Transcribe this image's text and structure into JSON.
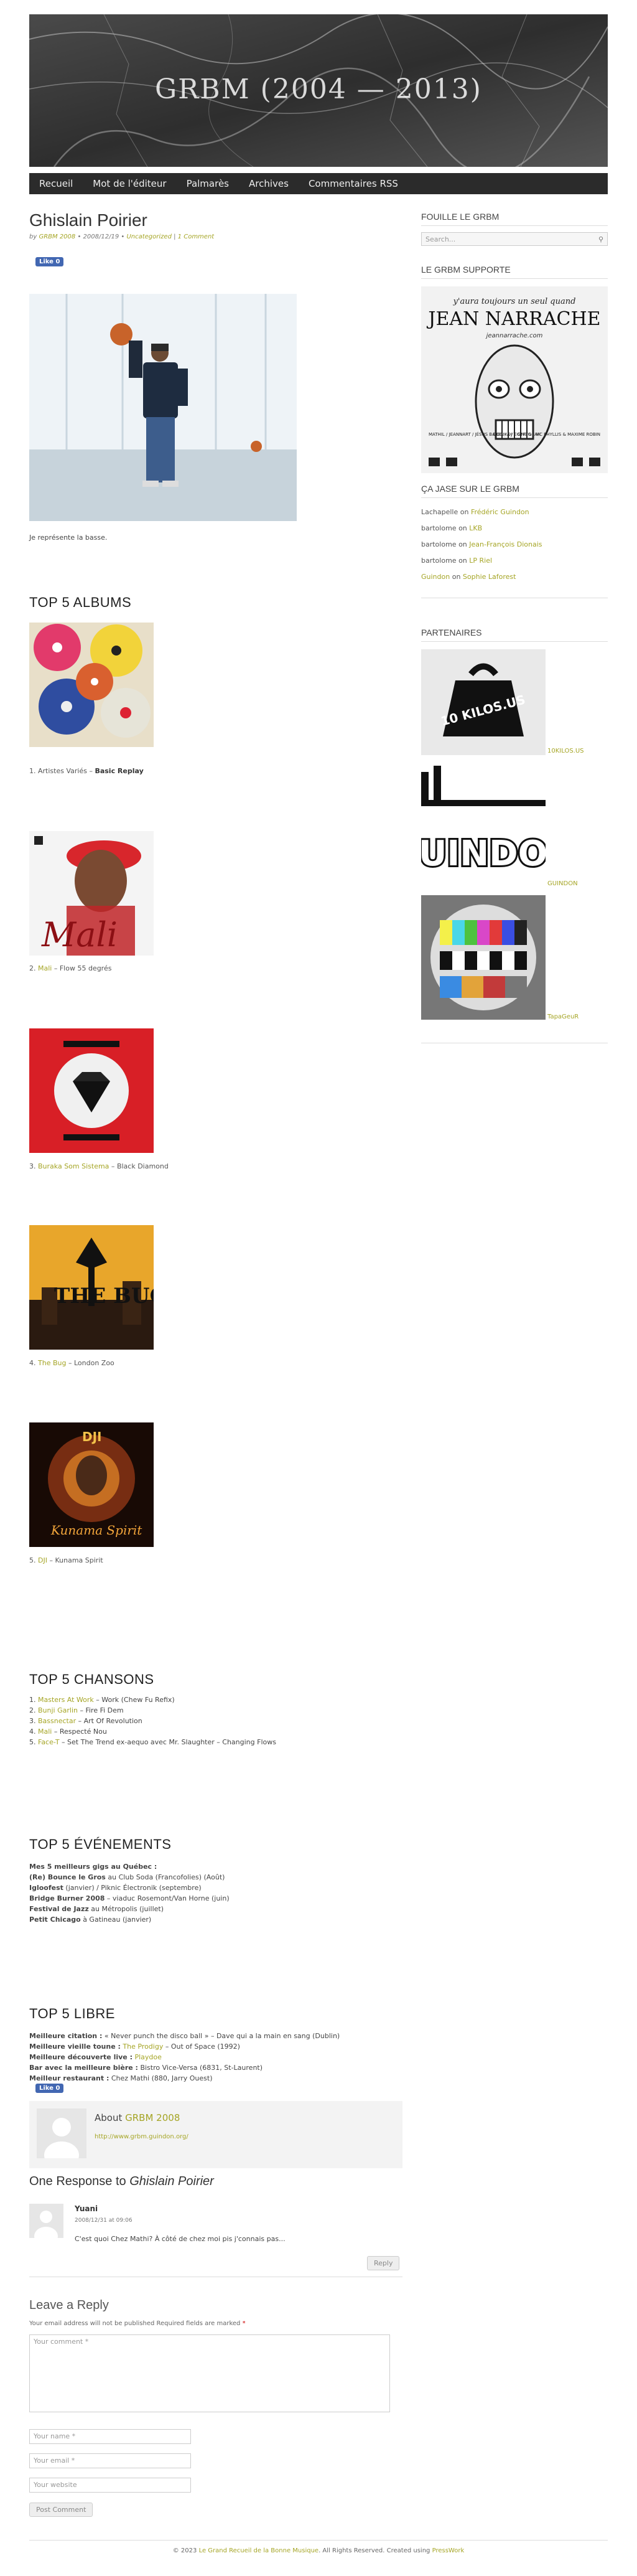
{
  "site": {
    "title": "GRBM (2004 — 2013)"
  },
  "nav": {
    "items": [
      "Recueil",
      "Mot de l'éditeur",
      "Palmarès",
      "Archives",
      "Commentaires RSS"
    ]
  },
  "post": {
    "title": "Ghislain Poirier",
    "meta_by": "by",
    "meta_author": "GRBM 2008",
    "meta_date": "• 2008/12/19 •",
    "meta_category": "Uncategorized",
    "meta_sep": "|",
    "meta_comments": "1 Comment",
    "like_label": "Like 0",
    "intro": "Je représente la basse."
  },
  "albums": {
    "heading": "TOP 5 ALBUMS",
    "items": [
      {
        "num": "1.",
        "artist": "Artistes Variés",
        "dash": " – ",
        "title": "Basic Replay",
        "linked": false
      },
      {
        "num": "2.",
        "artist": "Mali",
        "dash": " – ",
        "title": "Flow 55 degrés",
        "linked": true
      },
      {
        "num": "3.",
        "artist": "Buraka Som Sistema",
        "dash": " – ",
        "title": "Black Diamond",
        "linked": true
      },
      {
        "num": "4.",
        "artist": "The Bug",
        "dash": " – ",
        "title": "London Zoo",
        "linked": true
      },
      {
        "num": "5.",
        "artist": "DJI",
        "dash": " – ",
        "title": "Kunama Spirit",
        "linked": true
      }
    ]
  },
  "songs": {
    "heading": "TOP 5 CHANSONS",
    "items": [
      {
        "num": "1.",
        "artist": "Masters At Work",
        "rest": " – Work (Chew Fu Refix)"
      },
      {
        "num": "2.",
        "artist": "Bunji Garlin",
        "rest": " – Fire Fi Dem"
      },
      {
        "num": "3.",
        "artist": "Bassnectar",
        "rest": " – Art Of Revolution"
      },
      {
        "num": "4.",
        "artist": "Mali",
        "rest": " – Respecté Nou"
      },
      {
        "num": "5.",
        "artist": "Face-T",
        "rest": " – Set The Trend ex-aequo avec Mr. Slaughter – Changing Flows"
      }
    ]
  },
  "events": {
    "heading": "TOP 5 ÉVÉNEMENTS",
    "lines": [
      {
        "bold": "Mes 5 meilleurs gigs au Québec :",
        "rest": ""
      },
      {
        "bold": "(Re) Bounce le Gros",
        "rest": " au Club Soda (Francofolies) (Août)"
      },
      {
        "bold": "Igloofest",
        "rest": " (janvier) / Piknic Électronik (septembre)"
      },
      {
        "bold": "Bridge Burner 2008",
        "rest": " – viaduc Rosemont/Van Horne (juin)"
      },
      {
        "bold": "Festival de Jazz",
        "rest": " au Métropolis (juillet)"
      },
      {
        "bold": "Petit Chicago",
        "rest": " à Gatineau (janvier)"
      }
    ]
  },
  "libre": {
    "heading": "TOP 5 LIBRE",
    "lines": [
      {
        "bold": "Meilleure citation :",
        "rest": " « Never punch the disco ball » – Dave qui a la main en sang (Dublin)",
        "link": ""
      },
      {
        "bold": "Meilleure vieille toune :",
        "rest": " – Out of Space (1992)",
        "link": "The Prodigy"
      },
      {
        "bold": "Meilleure découverte live :",
        "rest": "",
        "link": "Playdoe"
      },
      {
        "bold": "Bar avec la meilleure bière :",
        "rest": " Bistro Vice-Versa (6831, St-Laurent)",
        "link": ""
      },
      {
        "bold": "Meilleur restaurant :",
        "rest": " Chez Mathi (880, Jarry Ouest)",
        "link": ""
      }
    ]
  },
  "author": {
    "about": "About",
    "name": "GRBM 2008",
    "url": "http://www.grbm.guindon.org/"
  },
  "responses": {
    "heading_pre": "One Response to",
    "heading_title": "Ghislain Poirier",
    "comment": {
      "author": "Yuani",
      "date": "2008/12/31 at 09:06",
      "text": "C'est quoi Chez Mathi? À côté de chez moi pis j'connais pas...",
      "reply": "Reply"
    }
  },
  "reply_form": {
    "heading": "Leave a Reply",
    "notice": "Your email address will not be published Required fields are marked",
    "comment_placeholder": "Your comment *",
    "name_placeholder": "Your name *",
    "email_placeholder": "Your email *",
    "website_placeholder": "Your website",
    "submit": "Post Comment"
  },
  "sidebar": {
    "search_heading": "FOUILLE LE GRBM",
    "search_placeholder": "Search...",
    "supporte_heading": "LE GRBM SUPPORTE",
    "ad": {
      "headline": "y'aura toujours un seul quand",
      "name": "JEAN NARRACHE",
      "site": "jeannarrache.com",
      "left_text": "MATHIL / JEANNART / JÉSUS BABEL / DJ T ONE & JAH",
      "right_text": "DOGMA / EGYPTO / MC PHYLLIS & MAXIME ROBIN"
    },
    "jase_heading": "ÇA JASE SUR LE GRBM",
    "recent_comments": [
      {
        "author": "Lachapelle",
        "on": "on",
        "post": "Frédéric Guindon"
      },
      {
        "author": "bartolome",
        "on": "on",
        "post": "LKB"
      },
      {
        "author": "bartolome",
        "on": "on",
        "post": "Jean-François Dionais"
      },
      {
        "author": "bartolome",
        "on": "on",
        "post": "LP Riel"
      },
      {
        "author": "Guindon",
        "on": "on",
        "post": "Sophie Laforest",
        "author_linked": true
      }
    ],
    "partners_heading": "PARTENAIRES",
    "partners": [
      {
        "label": "10KILOS.US",
        "logo_text": "10 KILOS.US"
      },
      {
        "label": "GUINDON",
        "logo_text": "GUINDON"
      },
      {
        "label": "TapaGeuR",
        "logo_text": ""
      }
    ]
  },
  "footer": {
    "copyright": "© 2023",
    "site_name": "Le Grand Recueil de la Bonne Musique",
    "rights": ". All Rights Reserved. Created using",
    "engine": "PressWork"
  }
}
